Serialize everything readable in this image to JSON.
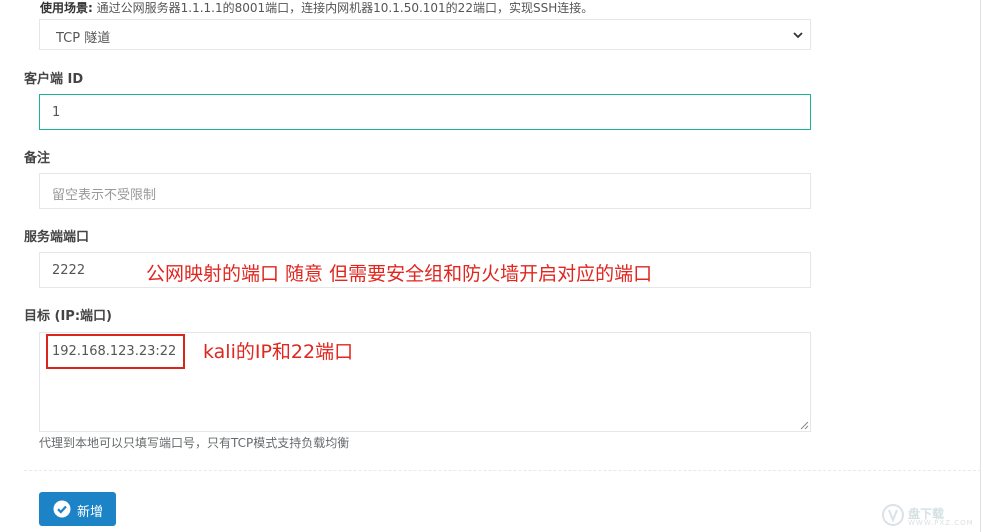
{
  "usage": {
    "label": "使用场景:",
    "text": "通过公网服务器1.1.1.1的8001端口，连接内网机器10.1.50.101的22端口，实现SSH连接。"
  },
  "tunnel_select": {
    "value": "TCP 隧道"
  },
  "client_id": {
    "label": "客户端 ID",
    "value": "1"
  },
  "remark": {
    "label": "备注",
    "placeholder": "留空表示不受限制"
  },
  "server_port": {
    "label": "服务端端口",
    "value": "2222"
  },
  "target": {
    "label": "目标 (IP:端口)",
    "value": "192.168.123.23:22",
    "help": "代理到本地可以只填写端口号，只有TCP模式支持负载均衡"
  },
  "annotations": {
    "server_port_note": "公网映射的端口 随意 但需要安全组和防火墙开启对应的端口",
    "target_note": "kali的IP和22端口"
  },
  "buttons": {
    "add": "新增"
  },
  "watermark": {
    "main": "盘下载",
    "sub": "WWW.PXZ.COM"
  },
  "colors": {
    "primary": "#1c84c6",
    "focus_border": "#1ab394",
    "annotation_red": "#e0261f"
  }
}
